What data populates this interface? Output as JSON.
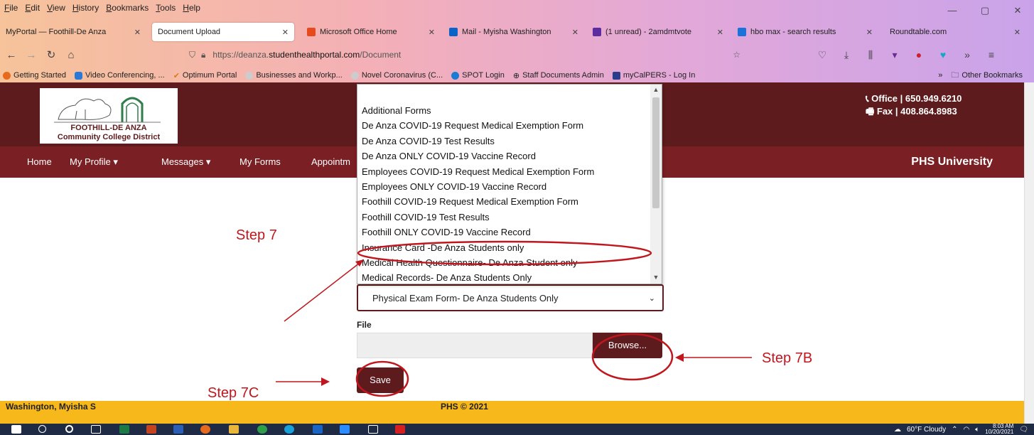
{
  "browser": {
    "menu": [
      "File",
      "Edit",
      "View",
      "History",
      "Bookmarks",
      "Tools",
      "Help"
    ],
    "tabs": [
      {
        "label": "MyPortal — Foothill-De Anza",
        "active": false
      },
      {
        "label": "Document Upload",
        "active": true
      },
      {
        "label": "Microsoft Office Home",
        "active": false
      },
      {
        "label": "Mail - Myisha Washington",
        "active": false
      },
      {
        "label": "(1 unread) - 2amdmtvote",
        "active": false
      },
      {
        "label": "hbo max - search results",
        "active": false
      },
      {
        "label": "Roundtable.com",
        "active": false
      }
    ],
    "url_prefix": "https://deanza.",
    "url_host": "studenthealthportal.com",
    "url_path": "/Document",
    "bookmarks": [
      "Getting Started",
      "Video Conferencing, ...",
      "Optimum Portal",
      "Businesses and Workp...",
      "Novel Coronavirus (C...",
      "SPOT Login",
      "Staff Documents Admin",
      "myCalPERS - Log In"
    ],
    "other_bookmarks": "Other Bookmarks"
  },
  "site": {
    "logo_name": "FOOTHILL-DE ANZA",
    "logo_sub": "Community College District",
    "office": "Office | 650.949.6210",
    "fax": "Fax | 408.864.8983",
    "nav": [
      "Home",
      "My Profile",
      "Messages",
      "My Forms",
      "Appointm"
    ],
    "brand": "PHS University",
    "colors": {
      "maroon": "#5e1b1d",
      "nav": "#7a1f24",
      "footer": "#f6b81a",
      "annotation": "#c0171e"
    }
  },
  "form": {
    "dropdown_options": [
      "Additional Forms",
      "De Anza COVID-19 Request Medical Exemption Form",
      "De Anza COVID-19 Test Results",
      "De Anza ONLY COVID-19 Vaccine Record",
      "Employees COVID-19 Request Medical Exemption Form",
      "Employees ONLY COVID-19 Vaccine Record",
      "Foothill COVID-19 Request Medical Exemption Form",
      "Foothill COVID-19 Test Results",
      "Foothill ONLY COVID-19 Vaccine Record",
      "Insurance Card -De Anza Students only",
      "Medical Health Questionnaire- De Anza Student only",
      "Medical Records- De Anza Students Only"
    ],
    "selected": "Physical Exam Form- De Anza Students Only",
    "file_label": "File",
    "browse_label": "Browse...",
    "save_label": "Save"
  },
  "footer": {
    "user": "Washington, Myisha S",
    "copyright": "PHS © 2021"
  },
  "annotations": {
    "step7": "Step 7",
    "step7b": "Step 7B",
    "step7c": "Step 7C"
  },
  "taskbar": {
    "weather": "60°F  Cloudy",
    "time": "8:03 AM",
    "date": "10/20/2021"
  }
}
